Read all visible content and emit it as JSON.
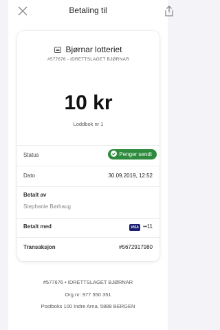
{
  "header": {
    "title": "Betaling til"
  },
  "merchant": {
    "name": "Bjørnar lotteriet",
    "subtitle": "#577676 - IDRETTSLAGET BJØRNAR"
  },
  "payment": {
    "amount": "10 kr",
    "description": "Loddbok nr 1"
  },
  "details": {
    "status_label": "Status",
    "status_value": "Penger sendt",
    "date_label": "Dato",
    "date_value": "30.09.2019, 12:52",
    "paid_by_label": "Betalt av",
    "paid_by_value": "Stephanie Børhaug",
    "paid_with_label": "Betalt med",
    "card_brand": "VISA",
    "card_last": "••11",
    "transaction_label": "Transaksjon",
    "transaction_value": "#5672917980"
  },
  "footer": {
    "line1": "#577676 • IDRETTSLAGET BJØRNAR",
    "line2": "Org.nr: 977 550 351",
    "line3": "Postboks 100 Indre Arna, 5888 BERGEN"
  },
  "colors": {
    "status_green": "#2e8b3e",
    "background": "#f4f3f7"
  }
}
